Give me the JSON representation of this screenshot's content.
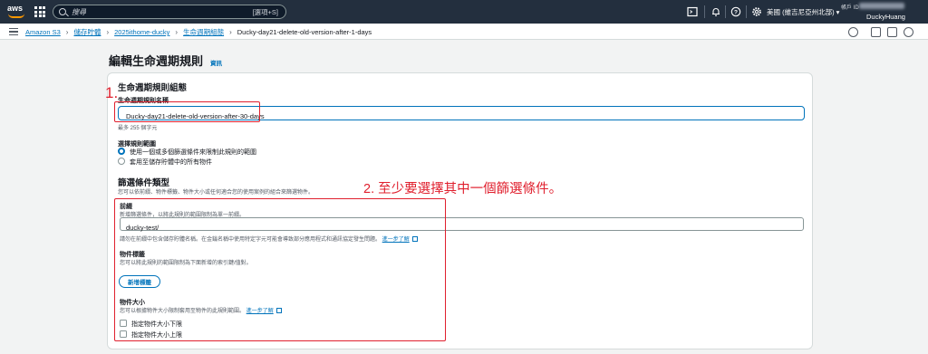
{
  "topnav": {
    "logo_text": "aws",
    "search_placeholder": "搜尋",
    "search_shortcut": "[選項+S]",
    "region": "美國 (維吉尼亞州北部) ▾",
    "account_label": "帳戶 ID",
    "username": "DuckyHuang"
  },
  "breadcrumb": {
    "items": [
      "Amazon S3",
      "儲存貯體",
      "2025ithome-ducky",
      "生命週期組態"
    ],
    "current": "Ducky-day21-delete-old-version-after-1-days"
  },
  "page": {
    "title": "編輯生命週期規則",
    "info": "資訊"
  },
  "config": {
    "heading": "生命週期規則組態",
    "name_label": "生命週期規則名稱",
    "name_value": "Ducky-day21-delete-old-version-after-30-days",
    "name_hint": "最多 255 個字元",
    "scope_label": "選擇規則範圍",
    "scope_options": [
      "使用一個或多個篩選條件來限制此規則的範圍",
      "套用至儲存貯體中的所有物件"
    ]
  },
  "filter": {
    "heading": "篩選條件類型",
    "description": "您可以依前綴、物件標籤、物件大小或任何適合您的使用案例的組合來篩選物件。",
    "prefix_label": "前綴",
    "prefix_desc": "新增篩選條件，以將此規則的範圍限制為單一前綴。",
    "prefix_value": "ducky-test/",
    "prefix_warning": "請勿在前綴中包含儲存貯體名稱。在金鑰名稱中使用特定字元可能會導致部分應用程式和通訊協定發生問題。",
    "learn_more": "進一步了解",
    "tags_label": "物件標籤",
    "tags_desc": "您可以將此規則的範圍限制為下面新增的索引鍵/值對。",
    "add_tag": "新增標籤",
    "size_label": "物件大小",
    "size_desc": "您可以根據物件大小限制套用至物件的此規則範圍。",
    "size_learn_more": "進一步了解",
    "size_min": "指定物件大小下限",
    "size_max": "指定物件大小上限"
  },
  "annotations": {
    "one": "1.",
    "two": "2. 至少要選擇其中一個篩選條件。"
  },
  "colors": {
    "nav_bg": "#232f3e",
    "accent": "#0073bb",
    "annotation": "#e0202e"
  }
}
